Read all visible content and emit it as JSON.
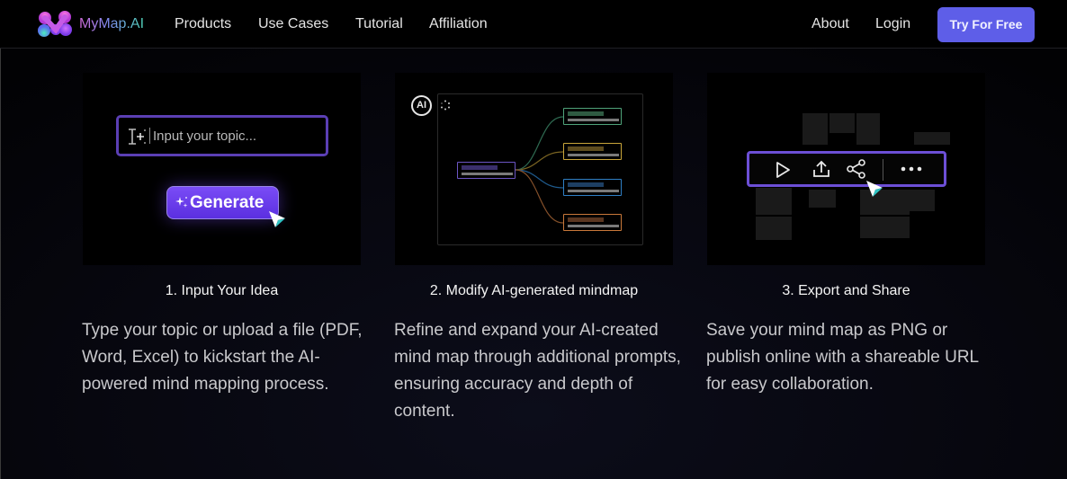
{
  "nav": {
    "brand": "MyMap.AI",
    "links": [
      "Products",
      "Use Cases",
      "Tutorial",
      "Affiliation"
    ],
    "right_links": [
      "About",
      "Login"
    ],
    "cta_label": "Try For Free",
    "cta_color": "#5e5ee8"
  },
  "steps": [
    {
      "title": "1. Input Your Idea",
      "description": "Type your topic or upload a file (PDF, Word, Excel) to kickstart the AI-powered mind mapping process.",
      "illustration": {
        "input_placeholder": "Input your topic...",
        "button_label": "Generate",
        "icons": [
          "text-cursor-sparkle-icon",
          "sparkle-icon",
          "mouse-cursor-icon"
        ]
      }
    },
    {
      "title": "2. Modify AI-generated mindmap",
      "description": "Refine and expand your AI-created mind map through additional prompts, ensuring accuracy and depth of content.",
      "illustration": {
        "badge": "AI",
        "icons": [
          "ai-badge-icon",
          "loading-spinner-icon"
        ],
        "node_colors": {
          "root": "#6b55c4",
          "branches": [
            "#4fa37a",
            "#c9a53a",
            "#2f7fc4",
            "#c8783a"
          ]
        }
      }
    },
    {
      "title": "3. Export and Share",
      "description": "Save your mind map as PNG or publish online with a shareable URL for easy collaboration.",
      "illustration": {
        "toolbar_icons": [
          "play-icon",
          "upload-icon",
          "share-icon",
          "more-icon"
        ]
      }
    }
  ]
}
